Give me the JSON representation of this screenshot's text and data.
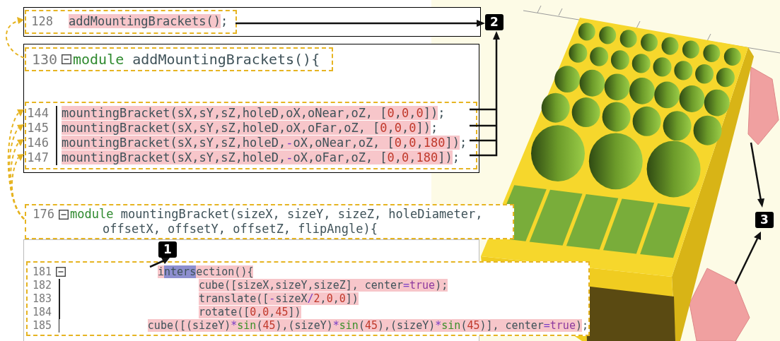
{
  "call_panel": {
    "lines": [
      {
        "number": "128",
        "foldable": false,
        "highlighted": true,
        "segments": [
          {
            "text": "addMountingBrackets()",
            "kind": "plain"
          }
        ],
        "tail": ";"
      }
    ]
  },
  "module_panel": {
    "header": {
      "number": "130",
      "foldable": true,
      "highlighted": false,
      "segments": [
        {
          "text": "module",
          "kind": "keyword"
        },
        {
          "text": " addMountingBrackets(){",
          "kind": "plain"
        }
      ]
    },
    "lines": [
      {
        "number": "144",
        "foldable": false,
        "highlighted": true,
        "segments": [
          {
            "text": "mountingBracket(sX,sY,sZ,holeD,oX,oNear,oZ, [",
            "kind": "plain"
          },
          {
            "text": "0",
            "kind": "number"
          },
          {
            "text": ",",
            "kind": "plain"
          },
          {
            "text": "0",
            "kind": "number"
          },
          {
            "text": ",",
            "kind": "plain"
          },
          {
            "text": "0",
            "kind": "number"
          },
          {
            "text": "])",
            "kind": "plain"
          }
        ],
        "tail": ";"
      },
      {
        "number": "145",
        "foldable": false,
        "highlighted": true,
        "segments": [
          {
            "text": "mountingBracket(sX,sY,sZ,holeD,oX,oFar,oZ, [",
            "kind": "plain"
          },
          {
            "text": "0",
            "kind": "number"
          },
          {
            "text": ",",
            "kind": "plain"
          },
          {
            "text": "0",
            "kind": "number"
          },
          {
            "text": ",",
            "kind": "plain"
          },
          {
            "text": "0",
            "kind": "number"
          },
          {
            "text": "])",
            "kind": "plain"
          }
        ],
        "tail": ";"
      },
      {
        "number": "146",
        "foldable": false,
        "highlighted": true,
        "segments": [
          {
            "text": "mountingBracket(sX,sY,sZ,holeD,",
            "kind": "plain"
          },
          {
            "text": "-",
            "kind": "operator"
          },
          {
            "text": "oX,oNear,oZ, [",
            "kind": "plain"
          },
          {
            "text": "0",
            "kind": "number"
          },
          {
            "text": ",",
            "kind": "plain"
          },
          {
            "text": "0",
            "kind": "number"
          },
          {
            "text": ",",
            "kind": "plain"
          },
          {
            "text": "180",
            "kind": "number"
          },
          {
            "text": "])",
            "kind": "plain"
          }
        ],
        "tail": ";"
      },
      {
        "number": "147",
        "foldable": false,
        "highlighted": true,
        "segments": [
          {
            "text": "mountingBracket(sX,sY,sZ,holeD,",
            "kind": "plain"
          },
          {
            "text": "-",
            "kind": "operator"
          },
          {
            "text": "oX,oFar,oZ, [",
            "kind": "plain"
          },
          {
            "text": "0",
            "kind": "number"
          },
          {
            "text": ",",
            "kind": "plain"
          },
          {
            "text": "0",
            "kind": "number"
          },
          {
            "text": ",",
            "kind": "plain"
          },
          {
            "text": "180",
            "kind": "number"
          },
          {
            "text": "])",
            "kind": "plain"
          }
        ],
        "tail": ";"
      }
    ]
  },
  "bracket_module_panel": {
    "lines": [
      {
        "number": "176",
        "foldable": true,
        "highlighted": false,
        "segments": [
          {
            "text": "module",
            "kind": "keyword"
          },
          {
            "text": " mountingBracket(sizeX, sizeY, sizeZ, holeDiameter,",
            "kind": "plain"
          }
        ]
      },
      {
        "foldable": false,
        "highlighted": false,
        "segments": [
          {
            "text": "offsetX, offsetY, offsetZ, flipAngle){",
            "kind": "plain"
          }
        ]
      }
    ]
  },
  "intersection_panel": {
    "lines": [
      {
        "number": "181",
        "foldable": true,
        "highlighted": true,
        "segments": [
          {
            "text": "i",
            "kind": "plain"
          },
          {
            "text": "nters",
            "kind": "selection"
          },
          {
            "text": "ection(){",
            "kind": "plain"
          }
        ],
        "children": [
          {
            "number": "182",
            "foldable": false,
            "highlighted": true,
            "segments": [
              {
                "text": "cube([sizeX,sizeY,sizeZ], center",
                "kind": "plain"
              },
              {
                "text": "=",
                "kind": "operator"
              },
              {
                "text": "true",
                "kind": "literal"
              },
              {
                "text": ");",
                "kind": "plain"
              }
            ]
          },
          {
            "number": "183",
            "foldable": false,
            "highlighted": true,
            "segments": [
              {
                "text": "translate([",
                "kind": "plain"
              },
              {
                "text": "-",
                "kind": "operator"
              },
              {
                "text": "sizeX",
                "kind": "plain"
              },
              {
                "text": "/",
                "kind": "operator"
              },
              {
                "text": "2",
                "kind": "number"
              },
              {
                "text": ",",
                "kind": "plain"
              },
              {
                "text": "0",
                "kind": "number"
              },
              {
                "text": ",",
                "kind": "plain"
              },
              {
                "text": "0",
                "kind": "number"
              },
              {
                "text": "])",
                "kind": "plain"
              }
            ]
          },
          {
            "number": "184",
            "foldable": false,
            "highlighted": true,
            "segments": [
              {
                "text": "rotate([",
                "kind": "plain"
              },
              {
                "text": "0",
                "kind": "number"
              },
              {
                "text": ",",
                "kind": "plain"
              },
              {
                "text": "0",
                "kind": "number"
              },
              {
                "text": ",",
                "kind": "plain"
              },
              {
                "text": "45",
                "kind": "number"
              },
              {
                "text": "])",
                "kind": "plain"
              }
            ]
          },
          {
            "number": "185",
            "foldable": false,
            "highlighted": true,
            "segments": [
              {
                "text": "cube([(sizeY)",
                "kind": "plain"
              },
              {
                "text": "*",
                "kind": "operator"
              },
              {
                "text": "sin",
                "kind": "builtin"
              },
              {
                "text": "(",
                "kind": "plain"
              },
              {
                "text": "45",
                "kind": "number"
              },
              {
                "text": "),(sizeY)",
                "kind": "plain"
              },
              {
                "text": "*",
                "kind": "operator"
              },
              {
                "text": "sin",
                "kind": "builtin"
              },
              {
                "text": "(",
                "kind": "plain"
              },
              {
                "text": "45",
                "kind": "number"
              },
              {
                "text": "),(sizeY)",
                "kind": "plain"
              },
              {
                "text": "*",
                "kind": "operator"
              },
              {
                "text": "sin",
                "kind": "builtin"
              },
              {
                "text": "(",
                "kind": "plain"
              },
              {
                "text": "45",
                "kind": "number"
              },
              {
                "text": ")], center",
                "kind": "plain"
              },
              {
                "text": "=",
                "kind": "operator"
              },
              {
                "text": "true",
                "kind": "literal"
              },
              {
                "text": ")",
                "kind": "plain"
              }
            ],
            "tail": ";"
          }
        ]
      }
    ]
  },
  "callouts": [
    {
      "label": "1"
    },
    {
      "label": "2"
    },
    {
      "label": "3"
    }
  ]
}
